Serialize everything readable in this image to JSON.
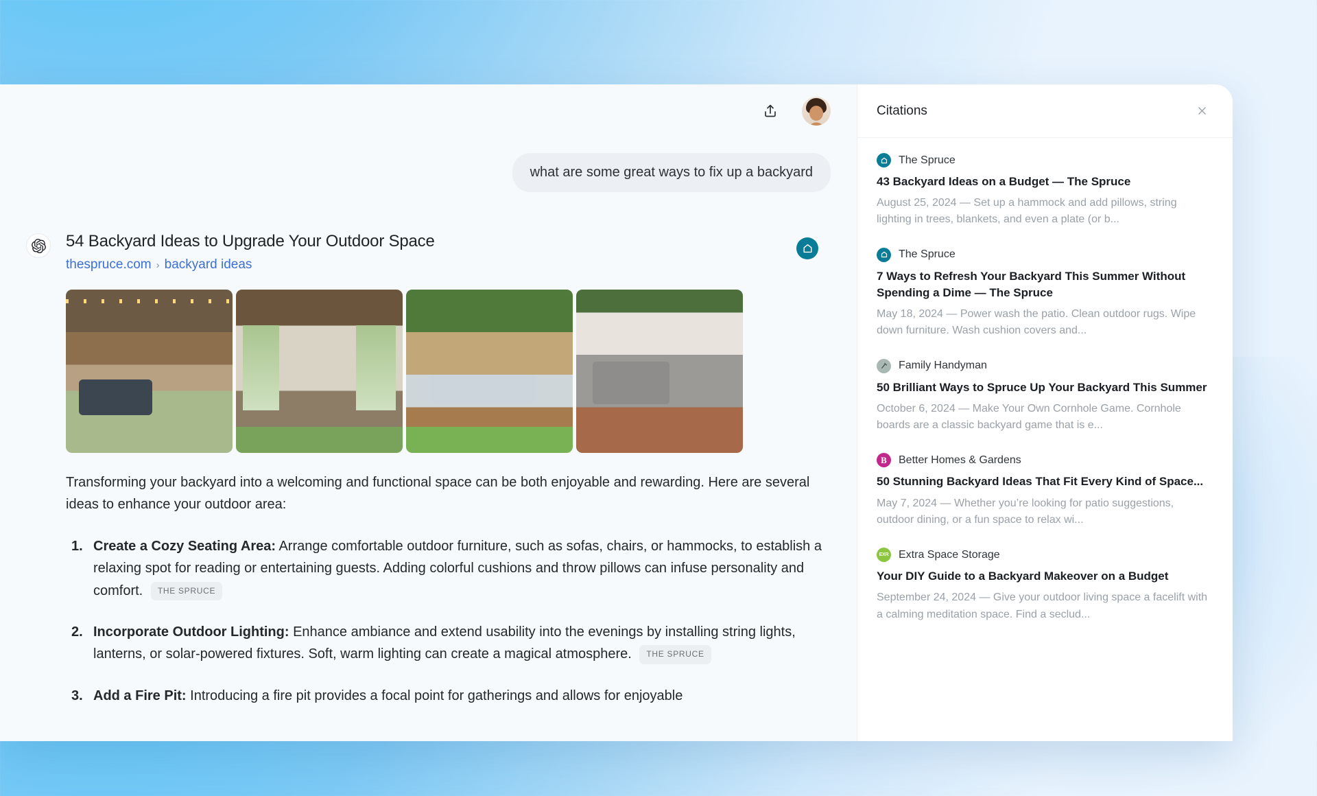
{
  "header": {
    "share_icon": "upload-share-icon",
    "avatar_label": "user-avatar"
  },
  "conversation": {
    "user_message": "what are some great ways to fix up a backyard",
    "assistant_mark": "openai-logo",
    "result_card": {
      "title": "54 Backyard Ideas to Upgrade Your Outdoor Space",
      "domain": "thespruce.com",
      "breadcrumb_separator": "›",
      "path": "backyard ideas",
      "source_badge": "the-spruce-logo"
    },
    "intro": "Transforming your backyard into a welcoming and functional space can be both enjoyable and rewarding. Here are several ideas to enhance your outdoor area:",
    "ideas": [
      {
        "num": "1.",
        "heading": "Create a Cozy Seating Area:",
        "body": "Arrange comfortable outdoor furniture, such as sofas, chairs, or hammocks, to establish a relaxing spot for reading or entertaining guests. Adding colorful cushions and throw pillows can infuse personality and comfort.",
        "chip": "THE SPRUCE"
      },
      {
        "num": "2.",
        "heading": "Incorporate Outdoor Lighting:",
        "body": "Enhance ambiance and extend usability into the evenings by installing string lights, lanterns, or solar-powered fixtures. Soft, warm lighting can create a magical atmosphere.",
        "chip": "THE SPRUCE"
      },
      {
        "num": "3.",
        "heading": "Add a Fire Pit:",
        "body": "Introducing a fire pit provides a focal point for gatherings and allows for enjoyable",
        "chip": ""
      }
    ],
    "thumbnails": [
      "backyard-string-lights-fire-pit-photo",
      "pergola-porch-swing-flowers-photo",
      "wooden-deck-sectional-sofa-photo",
      "pallet-seating-patio-cushions-photo"
    ]
  },
  "citations_panel": {
    "title": "Citations",
    "close_icon": "close-icon",
    "items": [
      {
        "source": "The Spruce",
        "icon": "spruce-house-icon",
        "title": "43 Backyard Ideas on a Budget — The Spruce",
        "snippet": "August 25, 2024 — Set up a hammock and add pillows, string lighting in trees, blankets, and even a plate (or b..."
      },
      {
        "source": "The Spruce",
        "icon": "spruce-house-icon",
        "title": "7 Ways to Refresh Your Backyard This Summer Without Spending a Dime — The Spruce",
        "snippet": "May 18, 2024 — Power wash the patio. Clean outdoor rugs. Wipe down furniture. Wash cushion covers and..."
      },
      {
        "source": "Family Handyman",
        "icon": "handyman-hammer-icon",
        "title": "50 Brilliant Ways to Spruce Up Your Backyard This Summer",
        "snippet": "October 6, 2024 — Make Your Own Cornhole Game. Cornhole boards are a classic backyard game that is e..."
      },
      {
        "source": "Better Homes & Gardens",
        "icon": "bhg-logo-icon",
        "title": "50 Stunning Backyard Ideas That Fit Every Kind of Space...",
        "snippet": "May 7, 2024 — Whether you’re looking for patio suggestions, outdoor dining, or a fun space to relax wi..."
      },
      {
        "source": "Extra Space Storage",
        "icon": "extra-space-storage-icon",
        "title": "Your DIY Guide to a Backyard Makeover on a Budget",
        "snippet": "September 24, 2024 — Give your outdoor living space a facelift with a calming meditation space. Find a seclud..."
      }
    ]
  },
  "colors": {
    "accent_link": "#3b6fd4",
    "spruce_teal": "#0b7c97",
    "bhg_magenta": "#c0288c",
    "exr_green": "#8cc63f",
    "background_blue": "#7cc9f5"
  }
}
